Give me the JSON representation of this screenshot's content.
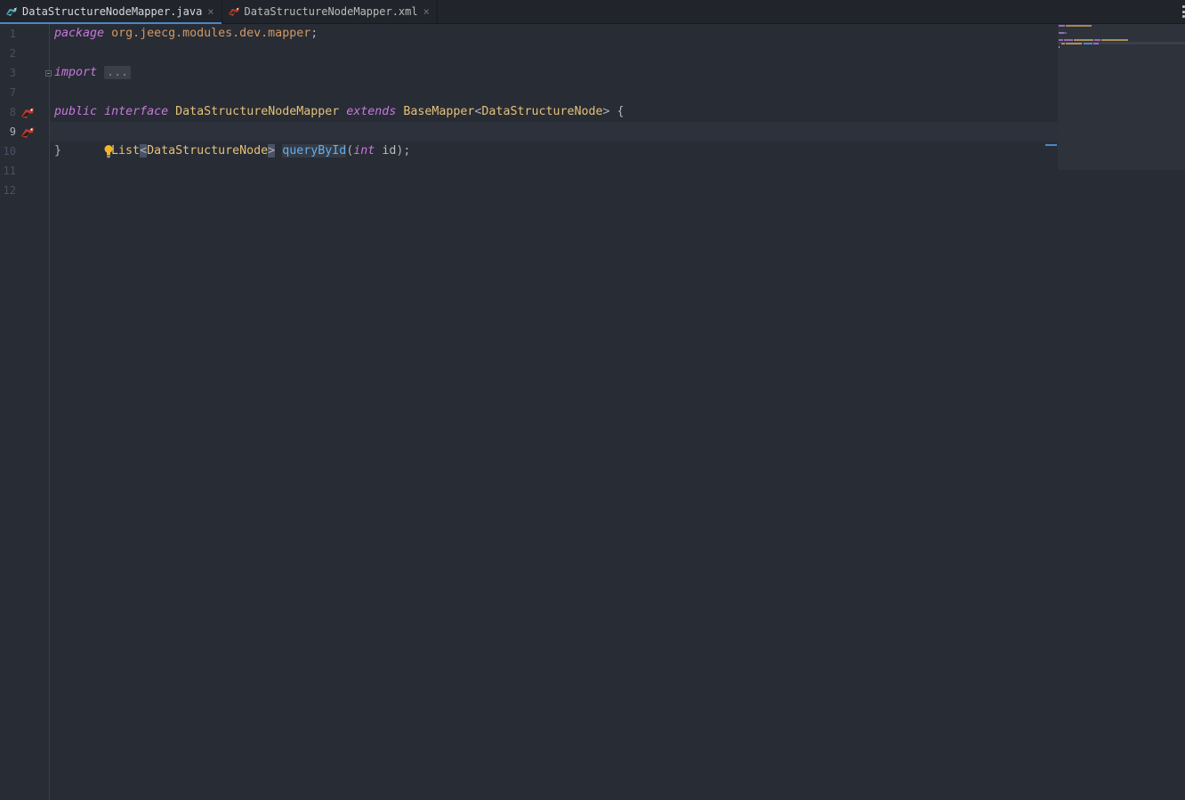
{
  "tabs": [
    {
      "label": "DataStructureNodeMapper.java",
      "active": true,
      "icon": "java-mapper-icon"
    },
    {
      "label": "DataStructureNodeMapper.xml",
      "active": false,
      "icon": "xml-mapper-icon"
    }
  ],
  "tab_close_glyph": "×",
  "gutter": {
    "line_numbers": [
      "1",
      "2",
      "3",
      "7",
      "8",
      "9",
      "10",
      "11",
      "12"
    ],
    "current_line": "9"
  },
  "code": {
    "line1": {
      "kw": "package",
      "pkg": "org.jeecg.modules.dev.mapper",
      "end": ";"
    },
    "line3": {
      "kw": "import",
      "folded": "..."
    },
    "line8": {
      "kw1": "public",
      "kw2": "interface",
      "name": "DataStructureNodeMapper",
      "kw3": "extends",
      "base": "BaseMapper",
      "lt": "<",
      "generic": "DataStructureNode",
      "gt": ">",
      "brace": "{"
    },
    "line9": {
      "type": "List",
      "lt": "<",
      "generic": "DataStructureNode",
      "gt": ">",
      "method": "queryById",
      "open": "(",
      "ptype": "int",
      "param": "id",
      "close": ");"
    },
    "line10": {
      "brace": "}"
    }
  },
  "colors": {
    "background": "#282c34",
    "keyword": "#c678dd",
    "type": "#e5c07b",
    "method": "#61afef",
    "accent": "#4a88c7",
    "ok": "#4caf50"
  },
  "inspection": {
    "icons": [
      "eye-slash-icon",
      "checkmark-icon"
    ]
  }
}
